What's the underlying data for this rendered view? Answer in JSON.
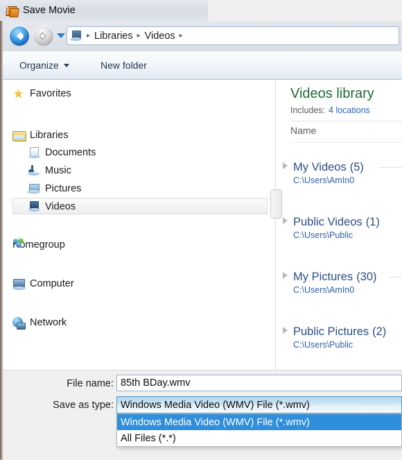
{
  "window": {
    "title": "Save Movie",
    "title_icon": "film-strip-icon"
  },
  "navigation": {
    "back_icon": "back-arrow-icon",
    "forward_icon": "forward-arrow-icon",
    "history_icon": "chevron-down-icon",
    "address_icon": "videos-library-icon",
    "breadcrumb": [
      "Libraries",
      "Videos"
    ],
    "separator": "▸"
  },
  "command_bar": {
    "organize": "Organize",
    "organize_caret": "▾",
    "new_folder": "New folder"
  },
  "sidebar": {
    "items": [
      {
        "label": "Favorites",
        "icon": "star-icon",
        "indent": 0,
        "selected": false
      },
      {
        "label": "Libraries",
        "icon": "folder-icon",
        "indent": 0,
        "selected": false
      },
      {
        "label": "Documents",
        "icon": "document-icon",
        "indent": 1,
        "selected": false
      },
      {
        "label": "Music",
        "icon": "music-note-icon",
        "indent": 1,
        "selected": false
      },
      {
        "label": "Pictures",
        "icon": "picture-icon",
        "indent": 1,
        "selected": false
      },
      {
        "label": "Videos",
        "icon": "video-icon",
        "indent": 1,
        "selected": true
      },
      {
        "label": "Homegroup",
        "icon": "homegroup-icon",
        "indent": 0,
        "selected": false
      },
      {
        "label": "Computer",
        "icon": "computer-icon",
        "indent": 0,
        "selected": false
      },
      {
        "label": "Network",
        "icon": "network-icon",
        "indent": 0,
        "selected": false
      }
    ]
  },
  "library": {
    "title": "Videos library",
    "includes_label": "Includes:",
    "locations_link": "4 locations",
    "column_header": "Name",
    "groups": [
      {
        "name": "My Videos",
        "count": "(5)",
        "path": "C:\\Users\\AmIn0",
        "expand_icon": "chevron-right-icon"
      },
      {
        "name": "Public Videos",
        "count": "(1)",
        "path": "C:\\Users\\Public",
        "expand_icon": "chevron-right-icon"
      },
      {
        "name": "My Pictures",
        "count": "(30)",
        "path": "C:\\Users\\AmIn0",
        "expand_icon": "chevron-right-icon"
      },
      {
        "name": "Public Pictures",
        "count": "(2)",
        "path": "C:\\Users\\Public",
        "expand_icon": "chevron-right-icon"
      }
    ]
  },
  "footer": {
    "file_name_label": "File name:",
    "file_name_value": "85th BDay.wmv",
    "save_as_type_label": "Save as type:",
    "save_as_type_value": "Windows Media Video (WMV) File (*.wmv)",
    "dropdown_open": true,
    "dropdown_options": [
      {
        "label": "Windows Media Video (WMV) File (*.wmv)",
        "selected": true
      },
      {
        "label": "All Files (*.*)",
        "selected": false
      }
    ]
  },
  "colors": {
    "library_title": "#1e6b33",
    "link_blue": "#2a62b8",
    "group_name": "#2b4d86",
    "dropdown_highlight": "#2f8fdd",
    "dialog_background": "#f0f0f0"
  }
}
